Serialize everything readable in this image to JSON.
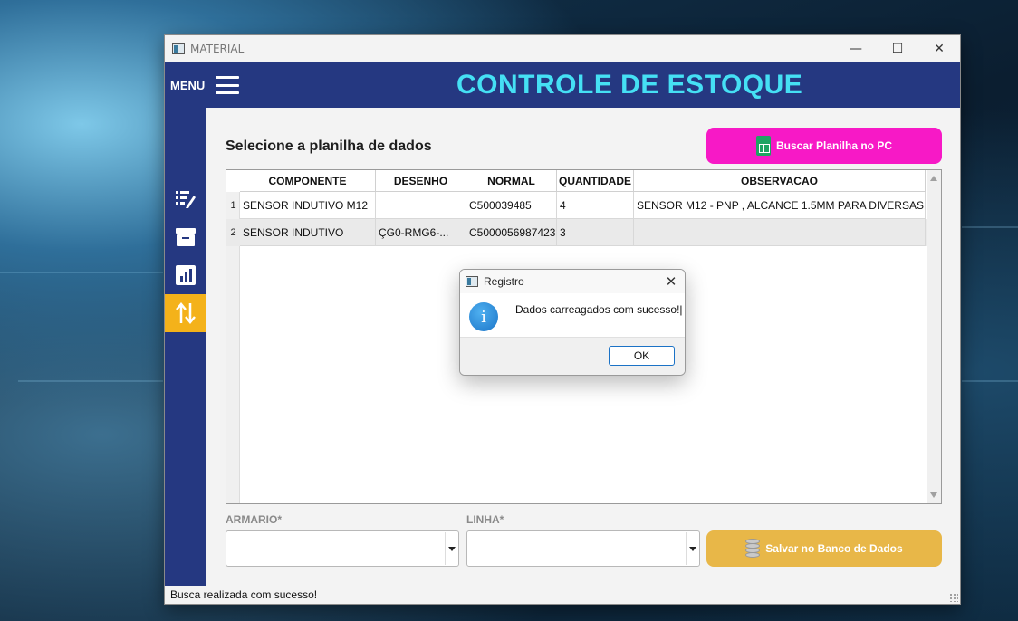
{
  "window": {
    "title": "MATERIAL",
    "controls": {
      "minimize": "—",
      "maximize": "☐",
      "close": "✕"
    }
  },
  "header": {
    "menu_label": "MENU",
    "app_title": "CONTROLE DE ESTOQUE"
  },
  "sidebar": {
    "items": [
      {
        "icon": "edit-list-icon",
        "active": false
      },
      {
        "icon": "archive-box-icon",
        "active": false
      },
      {
        "icon": "bar-chart-icon",
        "active": false
      },
      {
        "icon": "transfer-arrows-icon",
        "active": true
      }
    ],
    "active_color": "#f4b21a"
  },
  "main": {
    "section_title": "Selecione a planilha de dados",
    "buscar_button": {
      "label": "Buscar Planilha no PC",
      "icon": "spreadsheet-icon",
      "color": "#f719c6"
    },
    "table": {
      "columns": [
        "COMPONENTE",
        "DESENHO",
        "NORMAL",
        "QUANTIDADE",
        "OBSERVACAO"
      ],
      "rows": [
        {
          "num": "1",
          "cells": [
            "SENSOR INDUTIVO M12",
            "",
            "C500039485",
            "4",
            "SENSOR M12 - PNP , ALCANCE 1.5MM PARA DIVERSAS ..."
          ]
        },
        {
          "num": "2",
          "cells": [
            "SENSOR INDUTIVO",
            "ÇG0-RMG6-...",
            "C5000056987423",
            "3",
            ""
          ]
        }
      ]
    },
    "armario_label": "ARMARIO*",
    "linha_label": "LINHA*",
    "armario_value": "",
    "linha_value": "",
    "salvar_button": {
      "label": "Salvar no Banco de Dados",
      "icon": "database-icon",
      "color": "#e8b748"
    }
  },
  "status": {
    "text": "Busca realizada com sucesso!"
  },
  "dialog": {
    "title": "Registro",
    "message": "Dados carreagados com sucesso!|",
    "ok_label": "OK",
    "icon": "info-icon",
    "close": "✕"
  }
}
